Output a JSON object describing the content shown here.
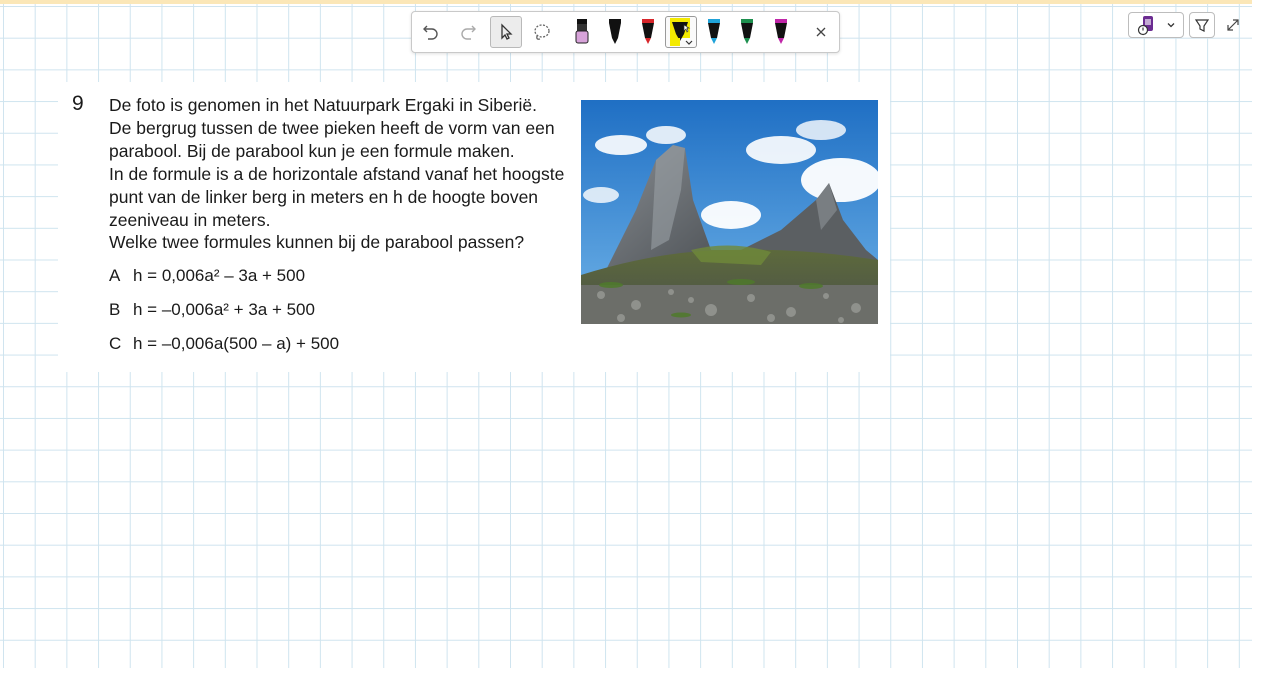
{
  "toolbar": {
    "tools": [
      {
        "name": "undo-icon"
      },
      {
        "name": "redo-icon"
      },
      {
        "name": "select-cursor-icon"
      },
      {
        "name": "lasso-icon"
      },
      {
        "name": "eraser-pen-icon",
        "color": "#d7a3d9"
      },
      {
        "name": "black-pen-icon",
        "color": "#111111"
      },
      {
        "name": "red-pen-icon",
        "color": "#d7262b"
      },
      {
        "name": "yellow-highlighter-icon",
        "color": "#f4ea00"
      },
      {
        "name": "blue-pen-icon",
        "color": "#1fa2d8"
      },
      {
        "name": "green-pen-icon",
        "color": "#1d8f4e"
      },
      {
        "name": "magenta-pen-icon",
        "color": "#c026a8"
      },
      {
        "name": "close-icon"
      }
    ]
  },
  "question": {
    "number": "9",
    "lines": [
      "De foto is genomen in het Natuurpark Ergaki in Siberië.",
      "De bergrug tussen de twee pieken heeft de vorm van een",
      "parabool. Bij de parabool kun je een formule maken.",
      "In de formule is a de horizontale afstand vanaf het hoogste",
      "punt van de linker berg in meters en h de hoogte boven",
      "zeeniveau in meters.",
      "Welke twee formules kunnen bij de parabool passen?"
    ],
    "options": [
      {
        "letter": "A",
        "formula": "h = 0,006a² – 3a + 500"
      },
      {
        "letter": "B",
        "formula": "h = –0,006a² + 3a + 500"
      },
      {
        "letter": "C",
        "formula": "h = –0,006a(500 – a) + 500"
      }
    ]
  },
  "photo": {
    "alt_name": "mountain-photo"
  }
}
